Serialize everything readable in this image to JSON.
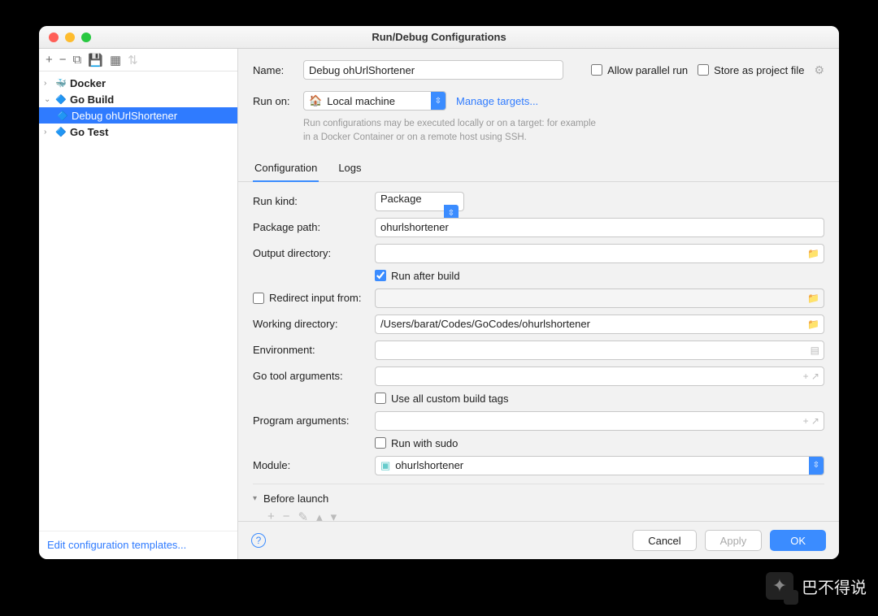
{
  "window": {
    "title": "Run/Debug Configurations"
  },
  "sidebar": {
    "items": [
      {
        "label": "Docker",
        "bold": true
      },
      {
        "label": "Go Build",
        "bold": true
      },
      {
        "label": "Debug ohUrlShortener",
        "bold": false,
        "selected": true
      },
      {
        "label": "Go Test",
        "bold": true
      }
    ],
    "footer_link": "Edit configuration templates..."
  },
  "header": {
    "name_label": "Name:",
    "name_value": "Debug ohUrlShortener",
    "allow_parallel": "Allow parallel run",
    "store_project": "Store as project file",
    "runon_label": "Run on:",
    "runon_value": "Local machine",
    "manage_targets": "Manage targets...",
    "hint": "Run configurations may be executed locally or on a target: for example in a Docker Container or on a remote host using SSH."
  },
  "tabs": {
    "configuration": "Configuration",
    "logs": "Logs"
  },
  "form": {
    "run_kind_label": "Run kind:",
    "run_kind_value": "Package",
    "package_path_label": "Package path:",
    "package_path_value": "ohurlshortener",
    "output_dir_label": "Output directory:",
    "output_dir_value": "",
    "run_after_build": "Run after build",
    "redirect_input": "Redirect input from:",
    "working_dir_label": "Working directory:",
    "working_dir_value": "/Users/barat/Codes/GoCodes/ohurlshortener",
    "env_label": "Environment:",
    "env_value": "",
    "go_tool_args_label": "Go tool arguments:",
    "go_tool_args_value": "",
    "use_custom_tags": "Use all custom build tags",
    "program_args_label": "Program arguments:",
    "program_args_value": "",
    "run_with_sudo": "Run with sudo",
    "module_label": "Module:",
    "module_value": "ohurlshortener",
    "before_launch": "Before launch"
  },
  "footer": {
    "cancel": "Cancel",
    "apply": "Apply",
    "ok": "OK"
  },
  "watermark": {
    "text": "巴不得说"
  }
}
